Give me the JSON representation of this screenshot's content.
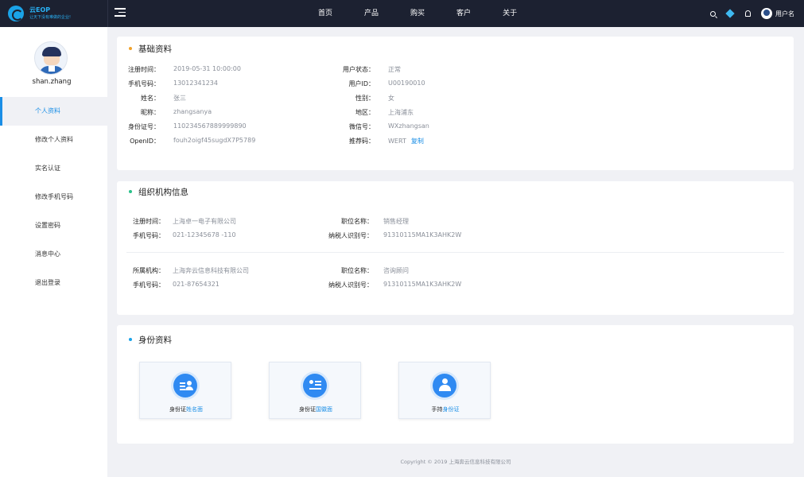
{
  "header": {
    "logo_title": "云EOP",
    "logo_sub": "让天下没有难做的企业!",
    "nav": [
      "首页",
      "产品",
      "购买",
      "客户",
      "关于"
    ],
    "username": "用户名"
  },
  "sidebar": {
    "profile_name": "shan.zhang",
    "items": [
      {
        "label": "个人资料"
      },
      {
        "label": "修改个人资料"
      },
      {
        "label": "实名认证"
      },
      {
        "label": "修改手机号码"
      },
      {
        "label": "设置密码"
      },
      {
        "label": "消息中心"
      },
      {
        "label": "退出登录"
      }
    ]
  },
  "basic": {
    "title": "基础资料",
    "left": [
      {
        "label": "注册时间：",
        "value": "2019-05-31 10:00:00"
      },
      {
        "label": "手机号码：",
        "value": "13012341234"
      },
      {
        "label": "姓名：",
        "value": "张三"
      },
      {
        "label": "昵称：",
        "value": "zhangsanya"
      },
      {
        "label": "身份证号：",
        "value": "110234567889999890"
      },
      {
        "label": "OpenID：",
        "value": "fouh2oigf45sugdX7P5789"
      }
    ],
    "right": [
      {
        "label": "用户状态：",
        "value": "正常"
      },
      {
        "label": "用户ID：",
        "value": "U00190010"
      },
      {
        "label": "性别：",
        "value": "女"
      },
      {
        "label": "地区：",
        "value": "上海浦东"
      },
      {
        "label": "微信号：",
        "value": "WXzhangsan"
      },
      {
        "label": "推荐码：",
        "value": "WERT"
      }
    ],
    "code_link": "复制"
  },
  "org": {
    "title": "组织机构信息",
    "groups": [
      {
        "left": [
          {
            "label": "注册时间：",
            "value": "上海卓一电子有限公司"
          },
          {
            "label": "手机号码：",
            "value": "021-12345678 -110"
          }
        ],
        "right": [
          {
            "label": "职位名称：",
            "value": "销售经理"
          },
          {
            "label": "纳税人识别号：",
            "value": "91310115MA1K3AHK2W"
          }
        ]
      },
      {
        "left": [
          {
            "label": "所属机构：",
            "value": "上海奔云信息科技有限公司"
          },
          {
            "label": "手机号码：",
            "value": "021-87654321"
          }
        ],
        "right": [
          {
            "label": "职位名称：",
            "value": "咨询顾问"
          },
          {
            "label": "纳税人识别号：",
            "value": "91310115MA1K3AHK2W"
          }
        ]
      }
    ]
  },
  "identity": {
    "title": "身份资料",
    "cards": [
      {
        "prefix": "身份证",
        "highlight": "姓名面"
      },
      {
        "prefix": "身份证",
        "highlight": "国徽面"
      },
      {
        "prefix": "手持",
        "highlight": "身份证"
      }
    ]
  },
  "footer": "Copyright © 2019 上海奔云信息科技有限公司",
  "colors": {
    "accent": "#1a8ee6",
    "dot_basic": "#f0a22b",
    "dot_org": "#2ac18a",
    "dot_identity": "#1aa3e8",
    "topbar": "#1c2131"
  }
}
